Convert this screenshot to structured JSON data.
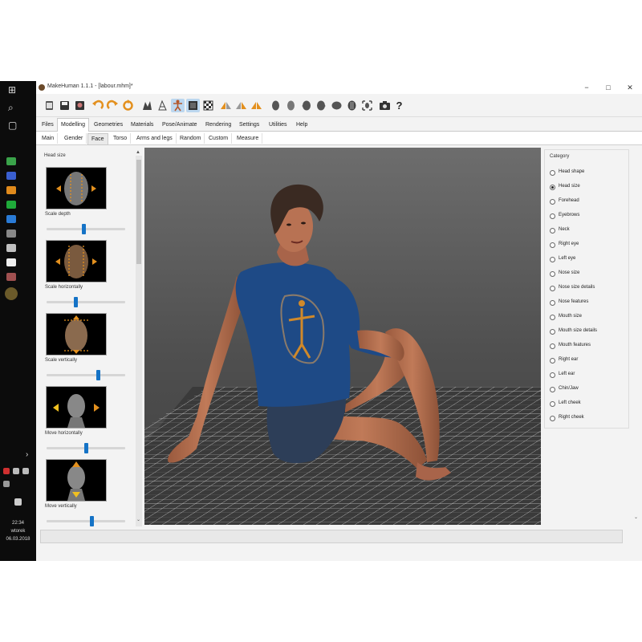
{
  "window": {
    "title": "MakeHuman 1.1.1 - [labour.mhm]*",
    "min_label": "−",
    "max_label": "□",
    "close_label": "✕"
  },
  "main_tabs": [
    "Files",
    "Modelling",
    "Geometries",
    "Materials",
    "Pose/Animate",
    "Rendering",
    "Settings",
    "Utilities",
    "Help"
  ],
  "active_main_tab": "Modelling",
  "sub_tabs": [
    "Main",
    "Gender",
    "Face",
    "Torso",
    "Arms and legs",
    "Random",
    "Custom",
    "Measure"
  ],
  "active_sub_tab": "Face",
  "toolbar": {
    "icons": [
      "new-file-icon",
      "save-icon",
      "export-icon",
      "undo-icon",
      "redo-icon",
      "reset-icon",
      "smooth-icon",
      "wireframe-icon",
      "pose-icon",
      "background-icon",
      "grid-icon",
      "symmetry-right-icon",
      "symmetry-left-icon",
      "symmetry-icon",
      "front-view-icon",
      "back-view-icon",
      "left-view-icon",
      "right-view-icon",
      "top-view-icon",
      "bottom-view-icon",
      "reset-camera-icon",
      "screenshot-icon",
      "help-icon"
    ],
    "help_label": "?"
  },
  "left_panel": {
    "group_label": "Head size",
    "sliders": [
      {
        "label": "Scale depth",
        "value": 0.47,
        "icon": "head-scale-depth-icon"
      },
      {
        "label": "Scale horizontally",
        "value": 0.37,
        "icon": "head-scale-horizontal-icon"
      },
      {
        "label": "Scale vertically",
        "value": 0.67,
        "icon": "head-scale-vertical-icon"
      },
      {
        "label": "Move horizontally",
        "value": 0.51,
        "icon": "head-move-horizontal-icon"
      },
      {
        "label": "Move vertically",
        "value": 0.58,
        "icon": "head-move-vertical-icon"
      }
    ],
    "scroll_up": "▲",
    "scroll_down": "⌄"
  },
  "right_panel": {
    "title": "Category",
    "options": [
      "Head shape",
      "Head size",
      "Forehead",
      "Eyebrows",
      "Neck",
      "Right eye",
      "Left eye",
      "Nose size",
      "Nose size details",
      "Nose features",
      "Mouth size",
      "Mouth size details",
      "Mouth features",
      "Right ear",
      "Left ear",
      "Chin/Jaw",
      "Left cheek",
      "Right cheek"
    ],
    "selected": "Head size",
    "scroll_down": "⌄"
  },
  "taskbar": {
    "time": "22:34",
    "user": "wtorek",
    "date": "06.03.2018",
    "chevron": "›"
  },
  "colors": {
    "accent": "#1573c6",
    "active_tool": "#bcd7ef",
    "viewport_top": "#6d6d6d",
    "shirt": "#1e4a86",
    "skin": "#b87253"
  }
}
